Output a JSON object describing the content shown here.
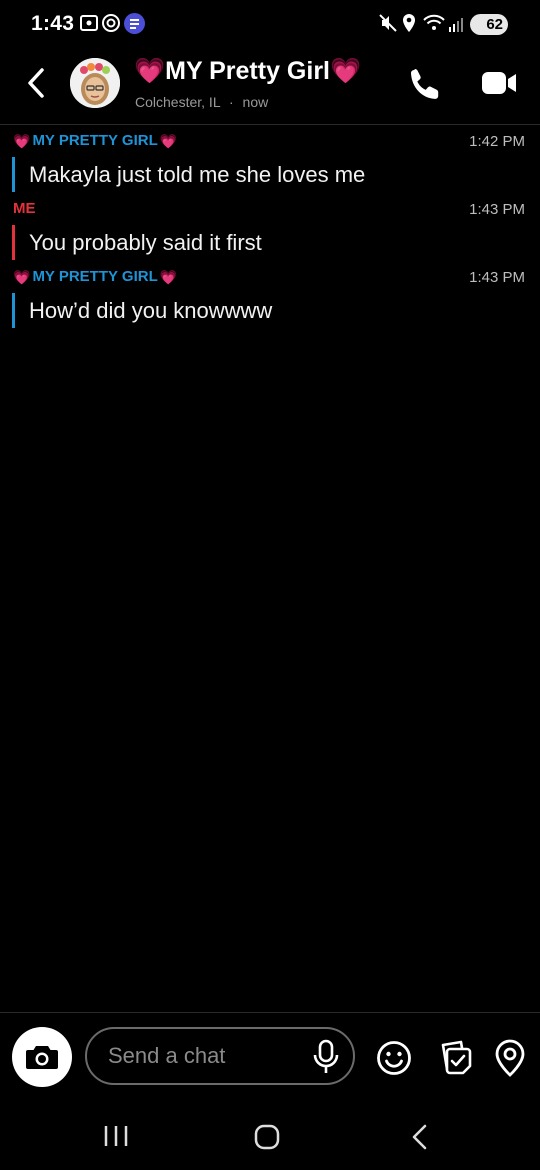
{
  "status_bar": {
    "time": "1:43",
    "battery": "62"
  },
  "header": {
    "title": "💗MY Pretty Girl💗",
    "location": "Colchester, IL",
    "separator": "·",
    "last_seen": "now"
  },
  "messages": [
    {
      "sender": "MY PRETTY GIRL",
      "sender_prefix": "💗",
      "sender_suffix": "💗",
      "time": "1:42 PM",
      "text": "Makayla just told me she loves me",
      "from_me": false
    },
    {
      "sender": "ME",
      "sender_prefix": "",
      "sender_suffix": "",
      "time": "1:43 PM",
      "text": "You probably said it first",
      "from_me": true
    },
    {
      "sender": "MY PRETTY GIRL",
      "sender_prefix": "💗",
      "sender_suffix": "💗",
      "time": "1:43 PM",
      "text": "How’d did you knowwww",
      "from_me": false
    }
  ],
  "compose": {
    "placeholder": "Send a chat"
  },
  "icons": {
    "back": "chevron-left-icon",
    "call": "phone-icon",
    "video": "video-camera-icon",
    "camera": "camera-icon",
    "mic": "microphone-icon",
    "emoji": "smiley-icon",
    "sticker": "sticker-icon",
    "location": "location-pin-icon"
  },
  "colors": {
    "them_accent": "#1e93d6",
    "me_accent": "#e3323c",
    "background": "#000000"
  }
}
